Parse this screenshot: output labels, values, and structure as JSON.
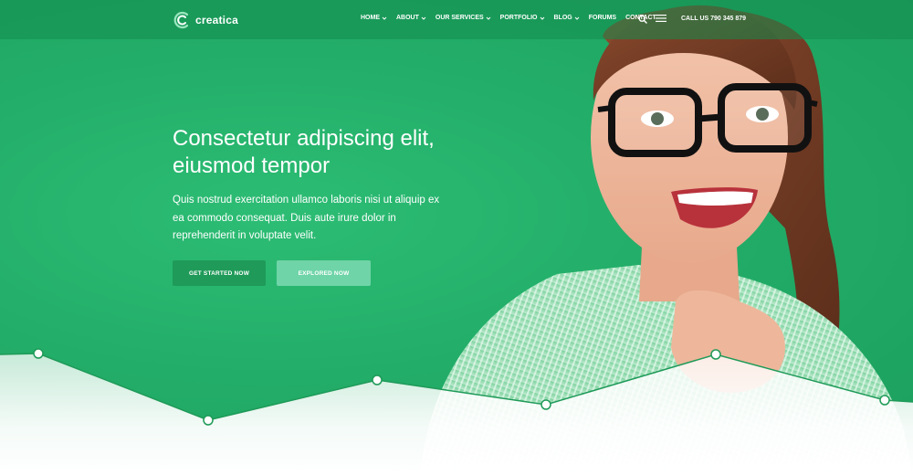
{
  "brand": {
    "name": "creatica"
  },
  "nav": {
    "items": [
      {
        "label": "HOME",
        "dropdown": true
      },
      {
        "label": "ABOUT",
        "dropdown": true
      },
      {
        "label": "OUR SERVICES",
        "dropdown": true
      },
      {
        "label": "PORTFOLIO",
        "dropdown": true
      },
      {
        "label": "BLOG",
        "dropdown": true
      },
      {
        "label": "FORUMS",
        "dropdown": false
      },
      {
        "label": "CONTACT",
        "dropdown": false
      }
    ],
    "phone": "CALL US 790 345 879"
  },
  "hero": {
    "headline_line1": "Consectetur adipiscing elit,",
    "headline_line2": "eiusmod tempor",
    "body_line1": "Quis nostrud exercitation ullamco laboris nisi ut aliquip ex",
    "body_line2": "ea commodo consequat. Duis aute irure dolor in",
    "body_line3": "reprehenderit in voluptate velit.",
    "primary_button": "GET STARTED NOW",
    "secondary_button": "EXPLORED NOW"
  },
  "colors": {
    "hero_green": "#22ad68",
    "button_primary": "#1f9a58",
    "button_secondary": "#6fd4a8"
  },
  "icons": [
    "logo-mark-icon",
    "chevron-down-icon",
    "search-icon",
    "hamburger-menu-icon"
  ]
}
